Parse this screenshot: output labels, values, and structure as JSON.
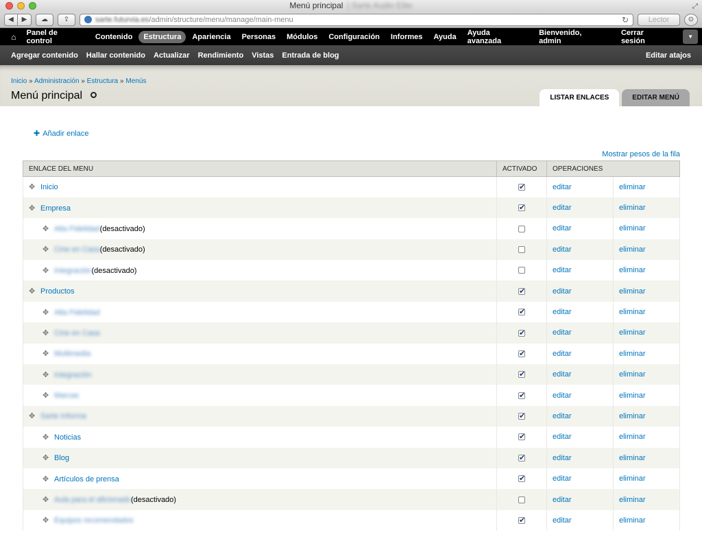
{
  "browser": {
    "window_title": "Menú principal",
    "title_suffix": "| Sarte Audio Elite",
    "url_host": "sarte.futurvia.es",
    "url_path": "/admin/structure/menu/manage/main-menu",
    "reader_label": "Lector"
  },
  "admin_menu": {
    "items": [
      "Panel de control",
      "Contenido",
      "Estructura",
      "Apariencia",
      "Personas",
      "Módulos",
      "Configuración",
      "Informes",
      "Ayuda",
      "Ayuda avanzada"
    ],
    "active_index": 2,
    "welcome_prefix": "Bienvenido, ",
    "welcome_user": "admin",
    "logout": "Cerrar sesión"
  },
  "shortcuts": {
    "items": [
      "Agregar contenido",
      "Hallar contenido",
      "Actualizar",
      "Rendimiento",
      "Vistas",
      "Entrada de blog"
    ],
    "edit_label": "Editar atajos"
  },
  "header": {
    "breadcrumb": [
      "Inicio",
      "Administración",
      "Estructura",
      "Menús"
    ],
    "breadcrumb_sep": "»",
    "title": "Menú principal",
    "tabs": [
      {
        "label": "Listar enlaces",
        "active": true
      },
      {
        "label": "Editar menú",
        "active": false
      }
    ]
  },
  "content": {
    "add_link": "Añadir enlace",
    "show_weights": "Mostrar pesos de la fila",
    "columns": {
      "item": "Enlace del menu",
      "enabled": "Activado",
      "operations": "Operaciones"
    },
    "edit_label": "editar",
    "delete_label": "eliminar",
    "rows": [
      {
        "title": "Inicio",
        "depth": 0,
        "enabled": true,
        "blurred": false,
        "note": ""
      },
      {
        "title": "Empresa",
        "depth": 0,
        "enabled": true,
        "blurred": false,
        "note": ""
      },
      {
        "title": "Alta Fidelidad",
        "depth": 1,
        "enabled": false,
        "blurred": true,
        "note": "(desactivado)"
      },
      {
        "title": "Cine en Casa",
        "depth": 1,
        "enabled": false,
        "blurred": true,
        "note": "(desactivado)"
      },
      {
        "title": "Integración",
        "depth": 1,
        "enabled": false,
        "blurred": true,
        "note": "(desactivado)"
      },
      {
        "title": "Productos",
        "depth": 0,
        "enabled": true,
        "blurred": false,
        "note": ""
      },
      {
        "title": "Alta Fidelidad",
        "depth": 1,
        "enabled": true,
        "blurred": true,
        "note": ""
      },
      {
        "title": "Cine en Casa",
        "depth": 1,
        "enabled": true,
        "blurred": true,
        "note": ""
      },
      {
        "title": "Multimedia",
        "depth": 1,
        "enabled": true,
        "blurred": true,
        "note": ""
      },
      {
        "title": "Integración",
        "depth": 1,
        "enabled": true,
        "blurred": true,
        "note": ""
      },
      {
        "title": "Marcas",
        "depth": 1,
        "enabled": true,
        "blurred": true,
        "note": ""
      },
      {
        "title": "Sarte Informa",
        "depth": 0,
        "enabled": true,
        "blurred": true,
        "note": ""
      },
      {
        "title": "Noticias",
        "depth": 1,
        "enabled": true,
        "blurred": false,
        "note": ""
      },
      {
        "title": "Blog",
        "depth": 1,
        "enabled": true,
        "blurred": false,
        "note": ""
      },
      {
        "title": "Artículos de prensa",
        "depth": 1,
        "enabled": true,
        "blurred": false,
        "note": ""
      },
      {
        "title": "Aula para el aficionado",
        "depth": 1,
        "enabled": false,
        "blurred": true,
        "note": "(desactivado)"
      },
      {
        "title": "Equipos recomendados",
        "depth": 1,
        "enabled": true,
        "blurred": true,
        "note": ""
      }
    ]
  }
}
